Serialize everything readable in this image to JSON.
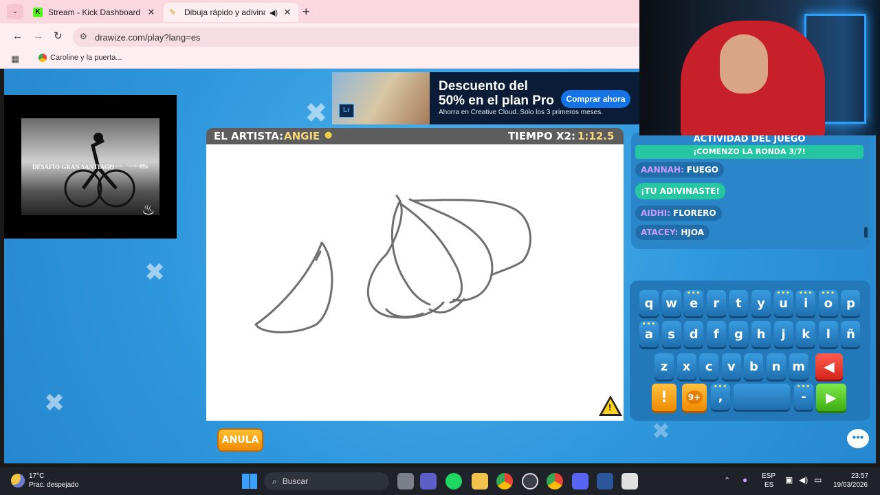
{
  "browser": {
    "tabs": [
      {
        "title": "Stream - Kick Dashboard",
        "active": false
      },
      {
        "title": "Dibuja rápido y adivina",
        "active": true
      }
    ],
    "url": "drawize.com/play?lang=es",
    "bookmarks": [
      {
        "label": "Caroline y la puerta..."
      }
    ]
  },
  "ad": {
    "line1": "Descuento del",
    "line2": "50% en el plan Pro",
    "sub": "Ahorra en Creative Cloud. Solo los 3 primeros meses.",
    "cta": "Comprar ahora",
    "logo": "Lr"
  },
  "video": {
    "title": "DESAFÍO GRAN SANTIAGO",
    "subtitle": "La Moneda · Fondiones",
    "count": "85k"
  },
  "game": {
    "artist_label": "EL ARTISTA:",
    "artist_name": "ANGIE",
    "timer_label": "TIEMPO X2:",
    "timer_value": "1:12.5",
    "skip_button": "ANULA",
    "warning_icon": "warning-icon"
  },
  "activity": {
    "title": "ACTIVIDAD DEL JUEGO",
    "round_banner": "¡COMENZO LA RONDA 3/7!",
    "messages": [
      {
        "user": "AANNAH:",
        "text": "FUEGO"
      },
      {
        "system": "¡TU ADIVINASTE!"
      },
      {
        "user": "AIDHI:",
        "text": "FLORERO"
      },
      {
        "user": "ATACEY:",
        "text": "HJOA"
      }
    ]
  },
  "keyboard": {
    "row1": [
      "q",
      "w",
      "e",
      "r",
      "t",
      "y",
      "u",
      "i",
      "o",
      "p"
    ],
    "row2": [
      "a",
      "s",
      "d",
      "f",
      "g",
      "h",
      "j",
      "k",
      "l",
      "ñ"
    ],
    "row3": [
      "z",
      "x",
      "c",
      "v",
      "b",
      "n",
      "m"
    ],
    "accent_keys": [
      "e",
      "u",
      "i",
      "o",
      "a"
    ],
    "row4": {
      "comma": ",",
      "dash": "-",
      "hint_badge": "9+"
    },
    "colors": {
      "backspace": "#e53935",
      "enter": "#5ad12a",
      "hint": "#f5a623"
    }
  },
  "taskbar": {
    "weather_temp": "17°C",
    "weather_desc": "Prac. despejado",
    "search_placeholder": "Buscar",
    "lang_top": "ESP",
    "lang_bottom": "ES",
    "time": "23:57",
    "date": "19/03/2026"
  }
}
